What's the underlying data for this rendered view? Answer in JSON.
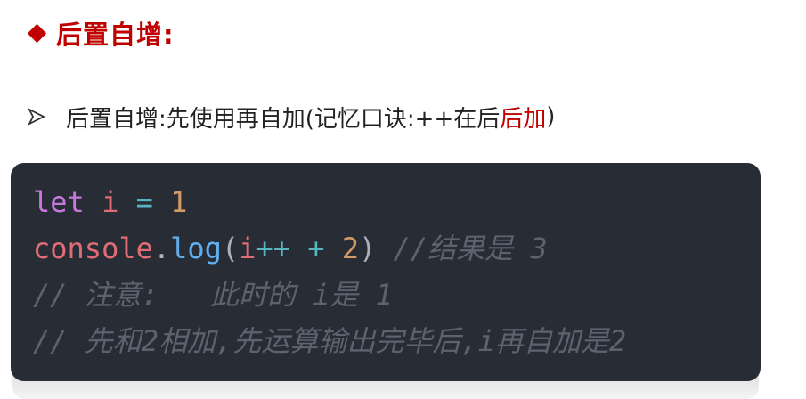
{
  "heading": {
    "text": "后置自增:"
  },
  "bullet": {
    "text_main": "后置自增:先使用再自加(记忆口诀:++在后 ",
    "text_highlight": "后加",
    "text_end": ")"
  },
  "code": {
    "line1": {
      "kw": "let",
      "var": "i",
      "op": "=",
      "num": "1"
    },
    "line2": {
      "obj": "console",
      "dot": ".",
      "fn": "log",
      "paren_open": "(",
      "var": "i",
      "op_inc": "++",
      "op_plus": "+",
      "num": "2",
      "paren_close": ")",
      "comment": "//结果是 3"
    },
    "line3": {
      "comment": "// 注意:   此时的 i是 1"
    },
    "line4": {
      "comment": "// 先和2相加,先运算输出完毕后,i再自加是2"
    }
  },
  "colors": {
    "accent": "#c00000",
    "code_bg": "#282c34",
    "keyword": "#c678dd",
    "variable": "#e06c75",
    "operator": "#56b6c2",
    "number": "#d19a66",
    "function": "#61afef",
    "comment": "#5c6370"
  }
}
